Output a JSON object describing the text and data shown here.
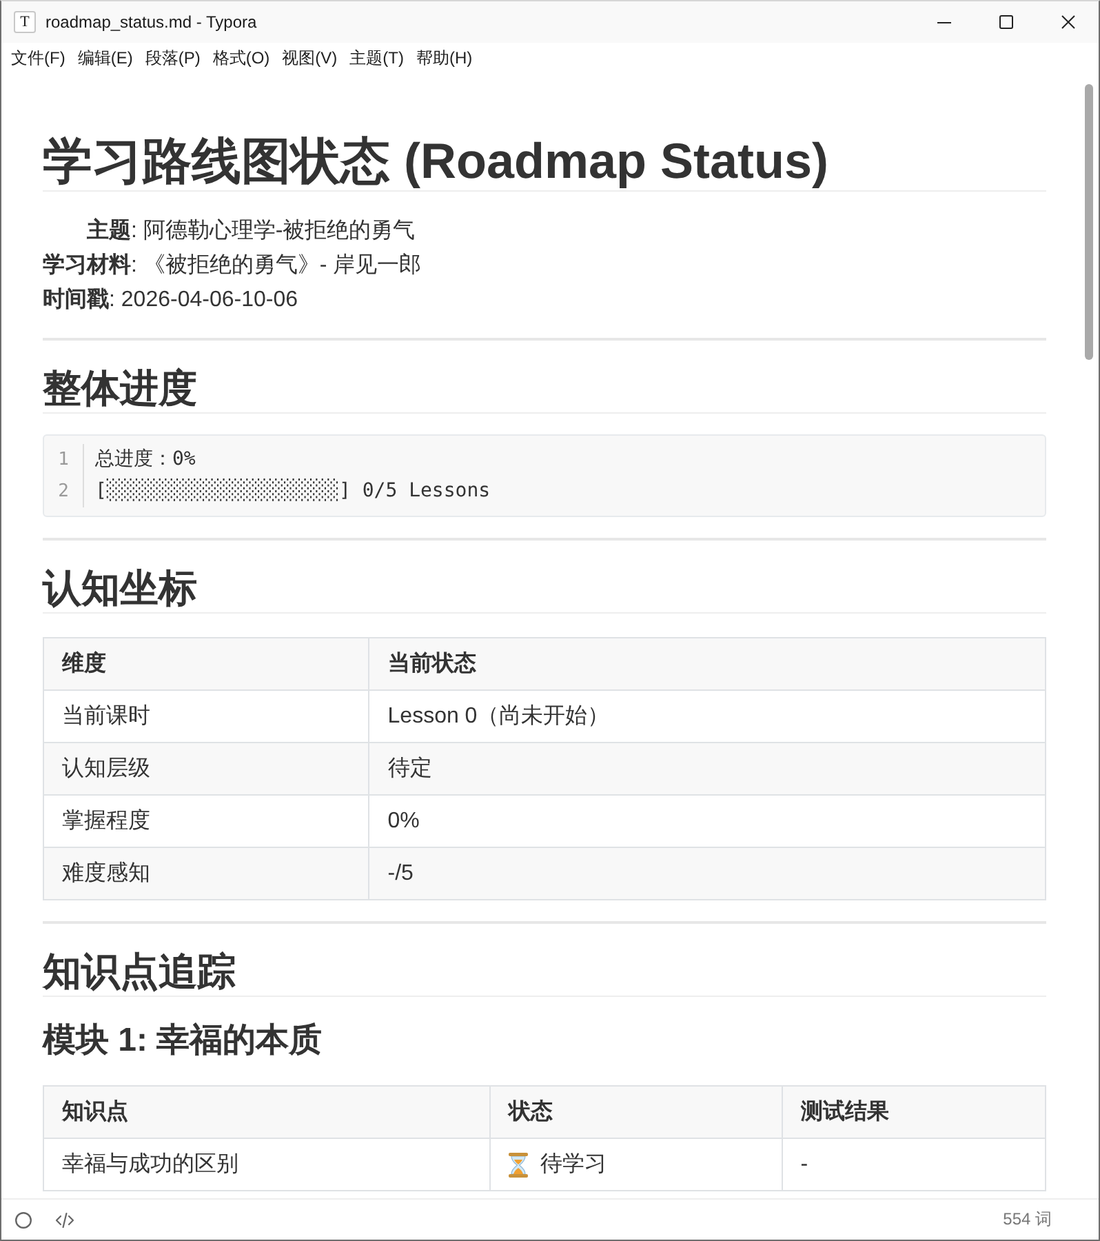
{
  "window": {
    "icon": "T",
    "title": "roadmap_status.md - Typora"
  },
  "menu": [
    "文件(F)",
    "编辑(E)",
    "段落(P)",
    "格式(O)",
    "视图(V)",
    "主题(T)",
    "帮助(H)"
  ],
  "document": {
    "title": "学习路线图状态 (Roadmap Status)",
    "meta": [
      {
        "text": "**主题**: 阿德勒心理学-被拒绝的勇气",
        "indented": true
      },
      {
        "text": "**学习材料**: 《被拒绝的勇气》- 岸见一郎",
        "indented": false
      },
      {
        "text": "**时间戳**: 2026-04-06-10-06",
        "indented": false
      }
    ],
    "blocks": [
      {
        "kind": "rule"
      },
      {
        "kind": "h2",
        "text": "整体进度"
      },
      {
        "kind": "code",
        "lines": [
          {
            "number": "1",
            "text": "总进度：0%"
          },
          {
            "number": "2",
            "text": "[░░░░░░░░░░░░░░░░░░░░] 0/5 Lessons"
          }
        ]
      },
      {
        "kind": "rule"
      },
      {
        "kind": "h2",
        "text": "认知坐标"
      },
      {
        "kind": "table",
        "columns": [
          "维度",
          "当前状态"
        ],
        "rows": [
          {
            "cells": [
              {
                "kind": "text",
                "text": "当前课时"
              },
              {
                "kind": "text",
                "text": "Lesson 0（尚未开始）"
              }
            ]
          },
          {
            "cells": [
              {
                "kind": "text",
                "text": "认知层级"
              },
              {
                "kind": "text",
                "text": "待定"
              }
            ]
          },
          {
            "cells": [
              {
                "kind": "text",
                "text": "掌握程度"
              },
              {
                "kind": "text",
                "text": "0%"
              }
            ]
          },
          {
            "cells": [
              {
                "kind": "text",
                "text": "难度感知"
              },
              {
                "kind": "text",
                "text": "-/5"
              }
            ]
          }
        ]
      },
      {
        "kind": "rule"
      },
      {
        "kind": "h2",
        "text": "知识点追踪"
      },
      {
        "kind": "h3",
        "text": "模块 1: 幸福的本质"
      },
      {
        "kind": "table",
        "columns": [
          "知识点",
          "状态",
          "测试结果"
        ],
        "rows": [
          {
            "cells": [
              {
                "kind": "text",
                "text": "幸福与成功的区别"
              },
              {
                "kind": "pending",
                "text": "待学习"
              },
              {
                "kind": "text",
                "text": "-"
              }
            ]
          }
        ]
      }
    ]
  },
  "status_bar": {
    "word_count": "554 词"
  }
}
